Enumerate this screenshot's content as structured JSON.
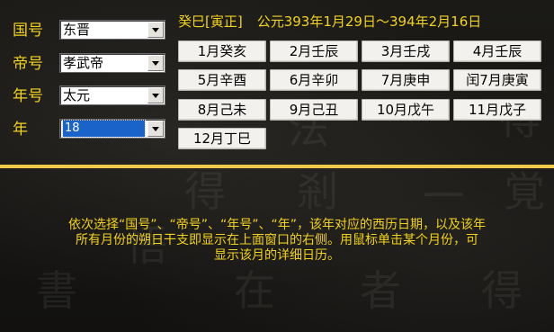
{
  "selectors": {
    "country_label": "国号",
    "country_value": "东晋",
    "emperor_label": "帝号",
    "emperor_value": "孝武帝",
    "era_label": "年号",
    "era_value": "太元",
    "year_label": "年",
    "year_value": "18"
  },
  "year_info": {
    "ganzhi": "癸巳[寅正]",
    "range": "公元393年1月29日～394年2月16日"
  },
  "months": [
    "1月癸亥",
    "2月壬辰",
    "3月壬戌",
    "4月壬辰",
    "5月辛酉",
    "6月辛卯",
    "7月庚申",
    "闰7月庚寅",
    "8月己未",
    "9月己丑",
    "10月戊午",
    "11月戊子",
    "12月丁巳"
  ],
  "instructions": {
    "line1": "依次选择“国号”、“帝号”、“年号”、“年”，该年对应的西历日期，以及该年",
    "line2": "所有月份的朔日干支即显示在上面窗口的右侧。用鼠标单击某个月份，可",
    "line3": "显示该月的详细日历。"
  },
  "colors": {
    "accent_text": "#f2d31c",
    "separator": "#f0c94a",
    "selection": "#1a63c9"
  }
}
